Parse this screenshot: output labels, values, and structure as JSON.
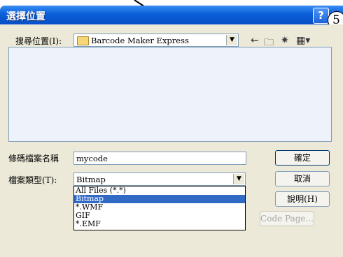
{
  "window": {
    "title": "選擇位置",
    "help_label": "?",
    "step_number": "5"
  },
  "toolbar": {
    "look_in_label": "搜尋位置(I):",
    "look_in_value": "Barcode Maker Express",
    "back_icon": "back-arrow-icon",
    "up_icon": "up-folder-icon",
    "new_folder_icon": "new-folder-icon",
    "view_icon": "view-menu-icon"
  },
  "form": {
    "filename_label": "條碼檔案名稱",
    "filename_value": "mycode",
    "filetype_label": "檔案類型(T):",
    "filetype_value": "Bitmap",
    "filetype_options": [
      "All Files (*.*)",
      "Bitmap",
      "*.WMF",
      "GIF",
      "*.EMF"
    ],
    "selected_index": 1
  },
  "buttons": {
    "ok": "確定",
    "cancel": "取消",
    "help": "說明(H)",
    "code_page": "Code Page..."
  },
  "colors": {
    "title_bar": "#0a5fd8",
    "dialog_bg": "#ece9d8",
    "selection": "#316ac5"
  }
}
